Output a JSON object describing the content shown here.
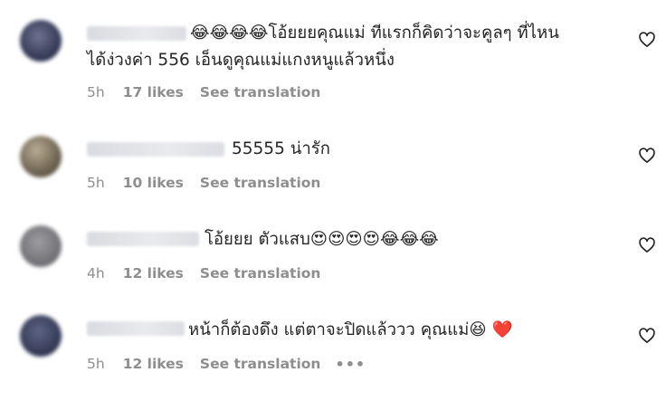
{
  "comments": [
    {
      "text_line1": "😂😂😂😂โอ้ยยยคุณแม่ ทีแรกก็คิดว่าจะคูลๆ ที่ไหน",
      "text_line2": "ได้ง่วงค่า 556 เอ็นดูคุณแม่แกงหนูแล้วหนึ่ง",
      "time": "5h",
      "likes": "17 likes",
      "translate": "See translation",
      "more": ""
    },
    {
      "text_line1": "55555 น่ารัก",
      "text_line2": "",
      "time": "5h",
      "likes": "10 likes",
      "translate": "See translation",
      "more": ""
    },
    {
      "text_line1": "โอ้ยยย ตัวแสบ😍😍😍😍😂😂😂",
      "text_line2": "",
      "time": "4h",
      "likes": "12 likes",
      "translate": "See translation",
      "more": ""
    },
    {
      "text_line1": "หน้าก็ต้องดึง แต่ตาจะปิดแล้ววว คุณแม่😆 ❤️",
      "text_line2": "",
      "time": "5h",
      "likes": "12 likes",
      "translate": "See translation",
      "more": "•••"
    }
  ],
  "icons": {
    "like": "heart-outline-icon"
  },
  "colors": {
    "text": "#262626",
    "meta": "#8e8e8e",
    "background": "#ffffff"
  }
}
